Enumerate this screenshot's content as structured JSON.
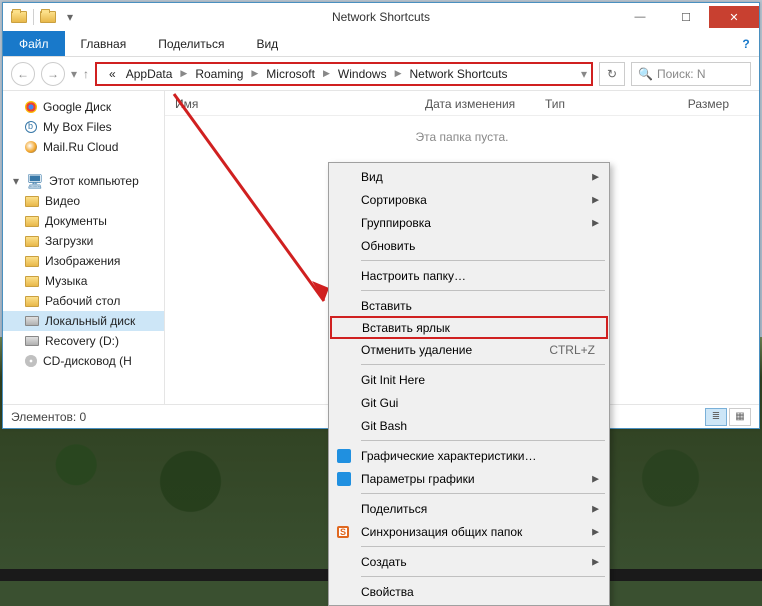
{
  "window": {
    "title": "Network Shortcuts"
  },
  "ribbon": {
    "file": "Файл",
    "home": "Главная",
    "share": "Поделиться",
    "view": "Вид"
  },
  "breadcrumb": {
    "prefix": "«",
    "items": [
      "AppData",
      "Roaming",
      "Microsoft",
      "Windows",
      "Network Shortcuts"
    ]
  },
  "search": {
    "placeholder": "Поиск: N"
  },
  "columns": {
    "name": "Имя",
    "date": "Дата изменения",
    "type": "Тип",
    "size": "Размер"
  },
  "empty": "Эта папка пуста.",
  "sidebar": {
    "top": [
      {
        "label": "Google Диск",
        "icon": "google"
      },
      {
        "label": "My Box Files",
        "icon": "mybox"
      },
      {
        "label": "Mail.Ru Cloud",
        "icon": "mail"
      }
    ],
    "computer_label": "Этот компьютер",
    "computer": [
      {
        "label": "Видео",
        "icon": "folder"
      },
      {
        "label": "Документы",
        "icon": "folder"
      },
      {
        "label": "Загрузки",
        "icon": "folder"
      },
      {
        "label": "Изображения",
        "icon": "folder"
      },
      {
        "label": "Музыка",
        "icon": "folder"
      },
      {
        "label": "Рабочий стол",
        "icon": "folder"
      },
      {
        "label": "Локальный диск",
        "icon": "drive",
        "selected": true
      },
      {
        "label": "Recovery (D:)",
        "icon": "drive"
      },
      {
        "label": "CD-дисковод (H",
        "icon": "disc"
      }
    ]
  },
  "status": {
    "elements": "Элементов: 0"
  },
  "contextmenu": {
    "view": "Вид",
    "sort": "Сортировка",
    "group": "Группировка",
    "refresh": "Обновить",
    "customize": "Настроить папку…",
    "paste": "Вставить",
    "paste_shortcut": "Вставить ярлык",
    "undo_delete": "Отменить удаление",
    "undo_shortcut": "CTRL+Z",
    "git_init": "Git Init Here",
    "git_gui": "Git Gui",
    "git_bash": "Git Bash",
    "gfx_char": "Графические характеристики…",
    "gfx_param": "Параметры графики",
    "share": "Поделиться",
    "sync": "Синхронизация общих папок",
    "create": "Создать",
    "properties": "Свойства"
  }
}
